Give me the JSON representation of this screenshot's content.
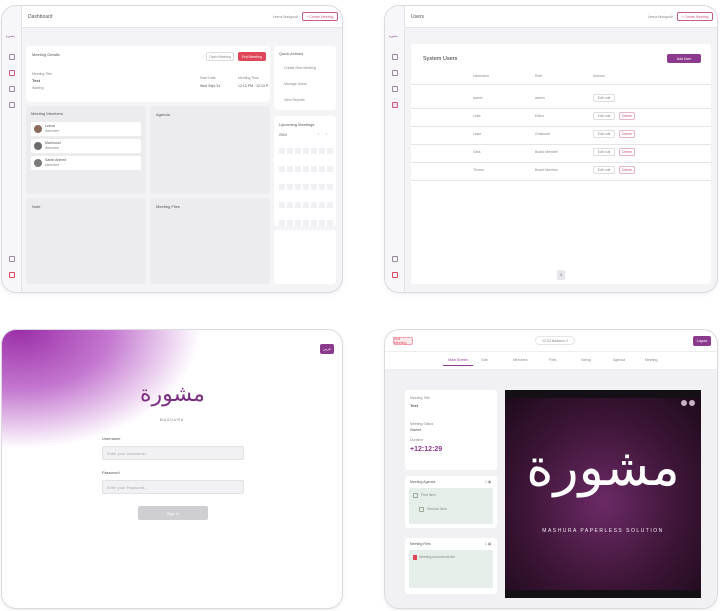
{
  "dashboard": {
    "title": "Dashboard",
    "user_info": "Leena Mahgoub",
    "create_btn": "+ Create Meeting",
    "meeting_details_title": "Meeting Details",
    "meeting_title_label": "Meeting Title",
    "meeting_title": "Test",
    "meeting_status": "Waiting",
    "start_date_label": "Start Date",
    "start_date": "Wed Sept 24",
    "start_time_label": "Meeting Time",
    "start_time": "12:13 PM - 12:13 PM",
    "open_btn": "Open Meeting",
    "end_btn": "End Meeting",
    "quick_actions_title": "Quick Actions",
    "quick_actions": [
      "Create New Meeting",
      "Manage Users",
      "View Reports"
    ],
    "members_title": "Meeting Members",
    "members": [
      {
        "name": "Leena",
        "role": "Attendee"
      },
      {
        "name": "Mahmoud",
        "role": "Attendee"
      },
      {
        "name": "Sarah Ahmed",
        "role": "Attendee"
      }
    ],
    "agenda_title": "Agenda",
    "upcoming_title": "Upcoming Meetings",
    "calendar_month": "2024",
    "calendar_weekdays": [
      "S",
      "M",
      "T",
      "W",
      "T",
      "F",
      "S"
    ],
    "notes_title": "Note",
    "files_title": "Meeting Files"
  },
  "users_page": {
    "title": "Users",
    "user_info": "Leena Mahgoub",
    "create_btn": "+ Create Meeting",
    "section_title": "System Users",
    "add_btn": "Add User",
    "columns": [
      "Username",
      "Role",
      "Actions"
    ],
    "rows": [
      {
        "username": "admin",
        "role": "admin",
        "edit": "Edit role",
        "delete": ""
      },
      {
        "username": "Leila",
        "role": "Editor",
        "edit": "Edit role",
        "delete": "Delete"
      },
      {
        "username": "Lead",
        "role": "Chairman",
        "edit": "Edit role",
        "delete": "Delete"
      },
      {
        "username": "Gina",
        "role": "Board Member",
        "edit": "Edit role",
        "delete": "Delete"
      },
      {
        "username": "Thorne",
        "role": "Board Member",
        "edit": "Edit role",
        "delete": "Delete"
      }
    ],
    "page_number": "1"
  },
  "login": {
    "logo_word": "مشورة",
    "brand": "MASHURA",
    "lang_btn": "عربي",
    "username_label": "Username",
    "username_placeholder": "Enter your Username...",
    "password_label": "Password",
    "password_placeholder": "Enter your Password...",
    "signin_btn": "Sign in"
  },
  "meeting": {
    "end_btn": "End Meeting",
    "timer_pill": "12:03 Nadeem 2",
    "logout_btn": "Logout",
    "tabs": [
      "Main Screen",
      "Vote",
      "Members",
      "Files",
      "Voting",
      "Agenda",
      "Meeting"
    ],
    "meeting_title_label": "Meeting Title",
    "meeting_title": "Test",
    "meeting_status_label": "Meeting Status",
    "meeting_status": "Started",
    "duration_label": "Duration",
    "timer": "+12:12:29",
    "agenda_title": "Meeting Agenda",
    "agenda_items": [
      "First Item",
      "Second Item"
    ],
    "files_title": "Meeting Files",
    "files_items": [
      "Meeting documents file"
    ],
    "screen_logo_word": "مشورة",
    "screen_subtitle": "MASHURA PAPERLESS SOLUTION"
  },
  "colors": {
    "brand_purple": "#8c3a8e",
    "accent_red": "#e0465a",
    "screen_bg": "#3a1434"
  }
}
